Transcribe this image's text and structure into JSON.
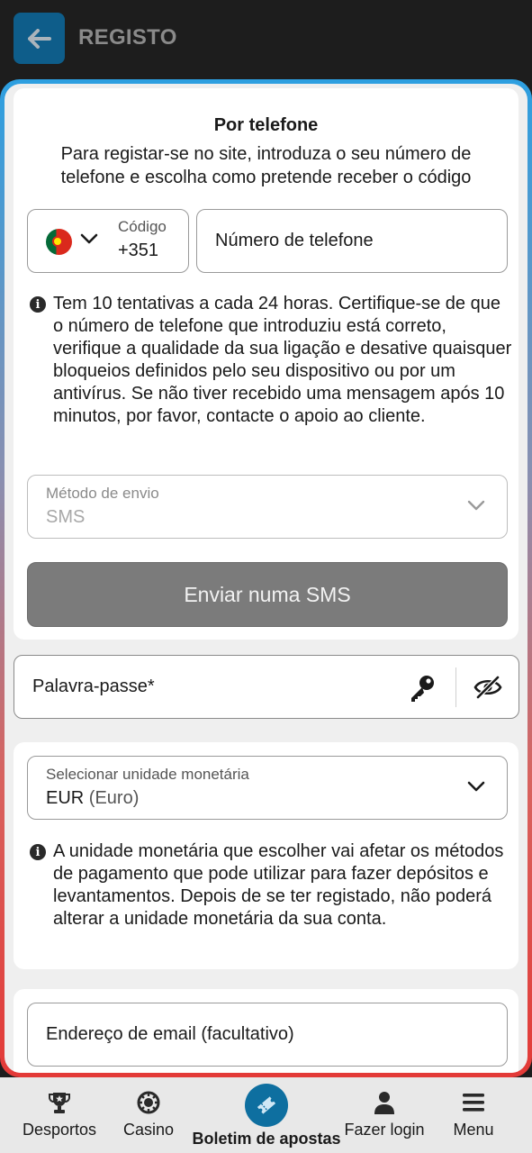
{
  "header": {
    "title": "REGISTO",
    "back_icon": "arrow-left-icon"
  },
  "phone_section": {
    "title": "Por telefone",
    "description": "Para registar-se no site, introduza o seu número de telefone e escolha como pretende receber o código",
    "country_code": {
      "label": "Código",
      "value": "+351",
      "flag_icon": "portugal-flag-icon"
    },
    "phone_placeholder": "Número de telefone",
    "attempts_info": "Tem 10 tentativas a cada 24 horas. Certifique-se de que o número de telefone que introduziu está correto, verifique a qualidade da sua ligação e desative quaisquer bloqueios definidos pelo seu dispositivo ou por um antivírus. Se não tiver recebido uma mensagem após 10 minutos, por favor, contacte o apoio ao cliente.",
    "method": {
      "label": "Método de envio",
      "value": "SMS"
    },
    "send_button": "Enviar numa SMS"
  },
  "password": {
    "placeholder": "Palavra-passe*",
    "key_icon": "key-icon",
    "visibility_icon": "eye-off-icon"
  },
  "currency": {
    "label": "Selecionar unidade monetária",
    "code": "EUR",
    "name": "(Euro)",
    "info": "A unidade monetária que escolher vai afetar os métodos de pagamento que pode utilizar para fazer depósitos e levantamentos. Depois de se ter registado, não poderá alterar a unidade monetária da sua conta."
  },
  "email": {
    "placeholder": "Endereço de email (facultativo)"
  },
  "bottom_nav": {
    "items": [
      {
        "label": "Desportos",
        "icon": "trophy-icon"
      },
      {
        "label": "Casino",
        "icon": "casino-chip-icon"
      },
      {
        "label": "Boletim de apostas",
        "icon": "ticket-icon"
      },
      {
        "label": "Fazer login",
        "icon": "user-icon"
      },
      {
        "label": "Menu",
        "icon": "hamburger-icon"
      }
    ]
  },
  "colors": {
    "header_bg": "#1d1d1d",
    "accent_blue": "#0e5d8a",
    "frame_top": "#2d9fe0",
    "frame_bottom": "#e33a37",
    "disabled_button": "#7b7b7b"
  }
}
